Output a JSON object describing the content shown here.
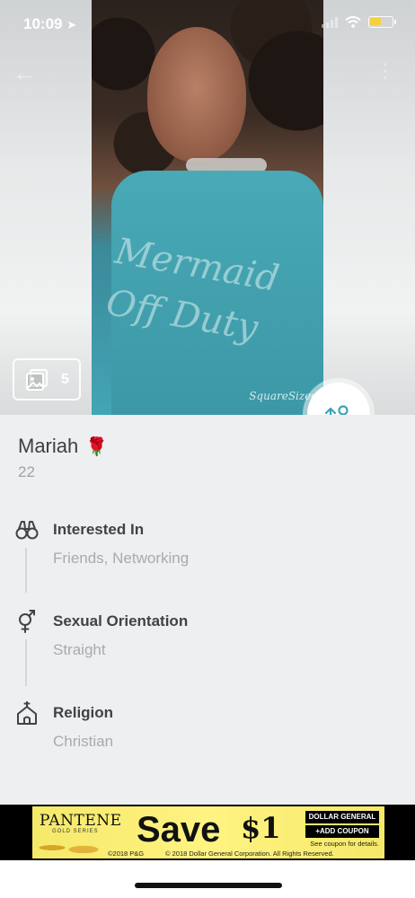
{
  "status_bar": {
    "time": "10:09"
  },
  "photo": {
    "count": "5",
    "watermark": "SquareSized",
    "shirt_text_1": "Mermaid",
    "shirt_text_2": "Off Duty"
  },
  "profile": {
    "name": "Mariah",
    "emoji": "🌹",
    "age": "22"
  },
  "details": [
    {
      "label": "Interested In",
      "value": "Friends, Networking",
      "icon": "binoculars-icon"
    },
    {
      "label": "Sexual Orientation",
      "value": "Straight",
      "icon": "gender-symbol-icon"
    },
    {
      "label": "Religion",
      "value": "Christian",
      "icon": "church-icon"
    }
  ],
  "ad": {
    "brand": "PANTENE",
    "brand_sub": "GOLD SERIES",
    "headline": "Save",
    "amount": "$1",
    "retailer": "DOLLAR GENERAL",
    "cta": "+ADD COUPON",
    "fine_print_1": "See coupon for details.",
    "fine_print_2": "© 2018 Dollar General Corporation. All Rights Reserved.",
    "copyright_pg": "©2018 P&G"
  },
  "colors": {
    "accent": "#3ba6b5",
    "background": "#edeff0",
    "label": "#3f4347",
    "muted": "#a7abaf"
  }
}
